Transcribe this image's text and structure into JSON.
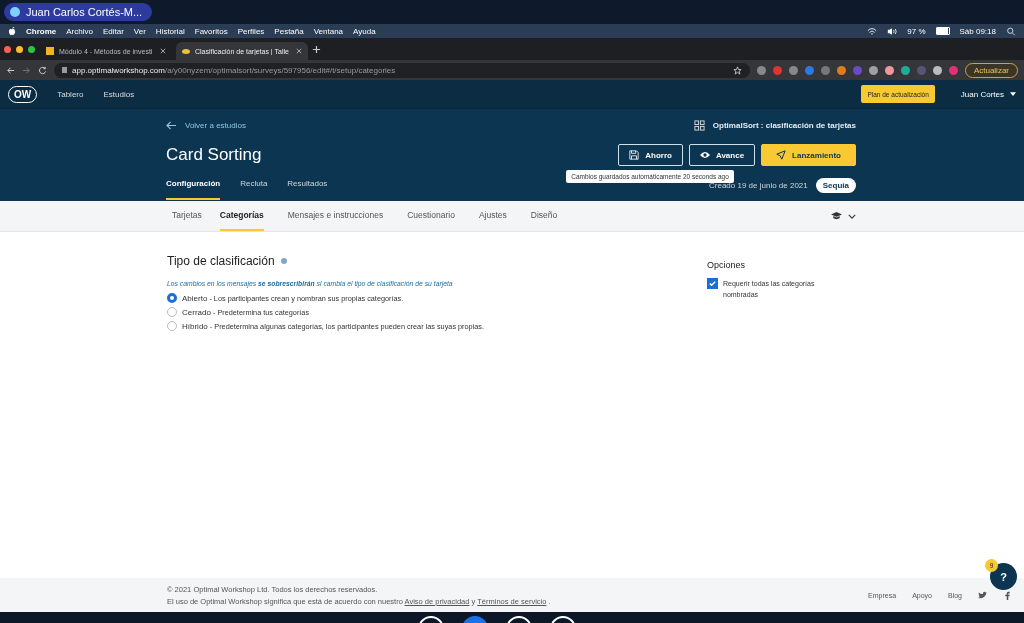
{
  "meeting_bar": {
    "speaker": "Juan Carlos Cortés-M..."
  },
  "menu_bar": {
    "app": "Chrome",
    "items": [
      "Archivo",
      "Editar",
      "Ver",
      "Historial",
      "Favoritos",
      "Perfiles",
      "Pestaña",
      "Ventana",
      "Ayuda"
    ],
    "battery": "97 %",
    "clock": "Sáb 09:18"
  },
  "browser_tabs": [
    {
      "title": "Módulo 4 - Métodos de investi",
      "selected": false
    },
    {
      "title": "Clasificación de tarjetas | Talle",
      "selected": true
    }
  ],
  "address_bar": {
    "host": "app.optimalworkshop.com",
    "path": "/a/y00nyzem/optimalsort/surveys/597956/edit#/t/setup/categories",
    "update_button": "Actualizar"
  },
  "app_nav": {
    "logo": "OW",
    "links": [
      "Tablero",
      "Estudios"
    ],
    "upgrade_button": "Plan de actualización",
    "user": "Juan Cortes"
  },
  "header": {
    "back_link": "Volver a estudios",
    "product": "OptimalSort : clasificación de tarjetas",
    "title": "Card Sorting",
    "buttons": [
      {
        "label": "Ahorro",
        "kind": "save"
      },
      {
        "label": "Avance",
        "kind": "preview"
      },
      {
        "label": "Lanzamiento",
        "kind": "launch"
      }
    ],
    "tooltip": "Cambios guardados automáticamente 20 seconds ago",
    "created": "Creado 19 de junio de 2021",
    "status_badge": "Sequía",
    "tabs": [
      {
        "label": "Configuración",
        "selected": true
      },
      {
        "label": "Recluta",
        "selected": false
      },
      {
        "label": "Resultados",
        "selected": false
      }
    ]
  },
  "sub_tabs": [
    {
      "label": "Tarjetas",
      "selected": false
    },
    {
      "label": "Categorías",
      "selected": true
    },
    {
      "label": "Mensajes e instrucciones",
      "selected": false
    },
    {
      "label": "Cuestionario",
      "selected": false
    },
    {
      "label": "Ajustes",
      "selected": false
    },
    {
      "label": "Diseño",
      "selected": false
    }
  ],
  "sort_type": {
    "heading": "Tipo de clasificación",
    "note": "Los cambios en los mensajes **se sobrescribirán** si cambia el tipo de clasificación de su tarjeta",
    "options": [
      {
        "name": "Abierto",
        "description": "- Los participantes crean y nombran sus propias categorías.",
        "selected": true
      },
      {
        "name": "Cerrado",
        "description": "- Predetermina tus categorías",
        "selected": false
      },
      {
        "name": "Híbrido",
        "description": "- Predetermina algunas categorías, los participantes pueden crear las suyas propias.",
        "selected": false
      }
    ]
  },
  "options_panel": {
    "heading": "Opciones",
    "items": [
      {
        "label": "Requerir todas las categorías nombradas",
        "checked": true
      }
    ]
  },
  "footer": {
    "copyright": "© 2021 Optimal Workshop Ltd. Todos los derechos reservados.",
    "terms_prefix": "El uso de Optimal Workshop significa que está de acuerdo con nuestro",
    "privacy_link": "Aviso de privacidad",
    "conjunction": "y",
    "terms_link": "Términos de servicio",
    "terms_suffix": ".",
    "links": [
      "Empresa",
      "Apoyo",
      "Blog"
    ]
  },
  "help": {
    "label": "?",
    "badge": "9"
  }
}
